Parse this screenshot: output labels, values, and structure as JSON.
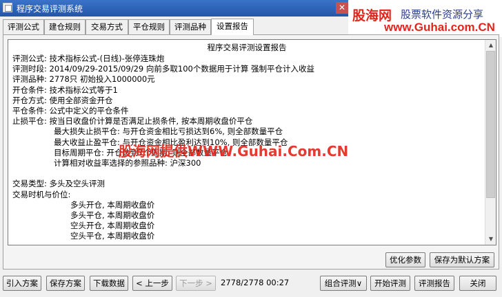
{
  "window": {
    "title": "程序交易评测系统",
    "close_glyph": "✕"
  },
  "watermark": {
    "brand": "股海网",
    "slogan": "股票软件资源分享",
    "url": "www.Guhai.com.CN",
    "overlay": "股海网提供WWW.Guhai.Com.CN"
  },
  "tabs": [
    "评测公式",
    "建仓规则",
    "交易方式",
    "平仓规则",
    "评测品种",
    "设置报告"
  ],
  "active_tab": "设置报告",
  "report": {
    "title": "程序交易评测设置报告",
    "lines": [
      {
        "text": "评测公式: 技术指标公式-(日线)-张停连珠炮",
        "indent": 0
      },
      {
        "text": "评测时段: 2014/09/29-2015/09/29 向前多取100个数据用于计算 强制平仓计入收益",
        "indent": 0
      },
      {
        "text": "评测品种: 2778只 初始投入1000000元",
        "indent": 0
      },
      {
        "text": "开仓条件: 技术指标公式等于1",
        "indent": 0
      },
      {
        "text": "开仓方式: 使用全部资金开仓",
        "indent": 0
      },
      {
        "text": "平仓条件: 公式中定义的平仓条件",
        "indent": 0
      },
      {
        "text": "止损平仓: 按当日收盘价计算是否满足止损条件, 按本周期收盘价平仓",
        "indent": 0
      },
      {
        "text": "最大损失止损平仓: 与开仓资金相比亏损达到6%, 则全部数量平仓",
        "indent": 1
      },
      {
        "text": "最大收益止盈平仓: 与开仓资金相比盈利达到10%, 则全部数量平仓",
        "indent": 1
      },
      {
        "text": "目标周期平仓: 开仓达到7个周期, 则全部数量平仓",
        "indent": 1
      },
      {
        "text": "计算相对收益率选择的参照品种: 沪深300",
        "indent": 1
      },
      {
        "text": "",
        "indent": 0
      },
      {
        "text": "交易类型: 多头及空头评测",
        "indent": 0
      },
      {
        "text": "交易时机与价位:",
        "indent": 0
      },
      {
        "text": "多头开仓, 本周期收盘价",
        "indent": 2
      },
      {
        "text": "多头平仓, 本周期收盘价",
        "indent": 2
      },
      {
        "text": "空头开仓, 本周期收盘价",
        "indent": 2
      },
      {
        "text": "空头平仓, 本周期收盘价",
        "indent": 2
      }
    ]
  },
  "panel_buttons": {
    "optimize": "优化参数",
    "save_default": "保存为默认方案"
  },
  "bottom_bar": {
    "import": "引入方案",
    "save": "保存方案",
    "download": "下载数据",
    "prev": "< 上一步",
    "next": "下一步 >",
    "status": "2778/2778 00:27",
    "combo_eval": "组合评测∨",
    "start_eval": "开始评测",
    "eval_report": "评测报告",
    "close": "关闭"
  }
}
